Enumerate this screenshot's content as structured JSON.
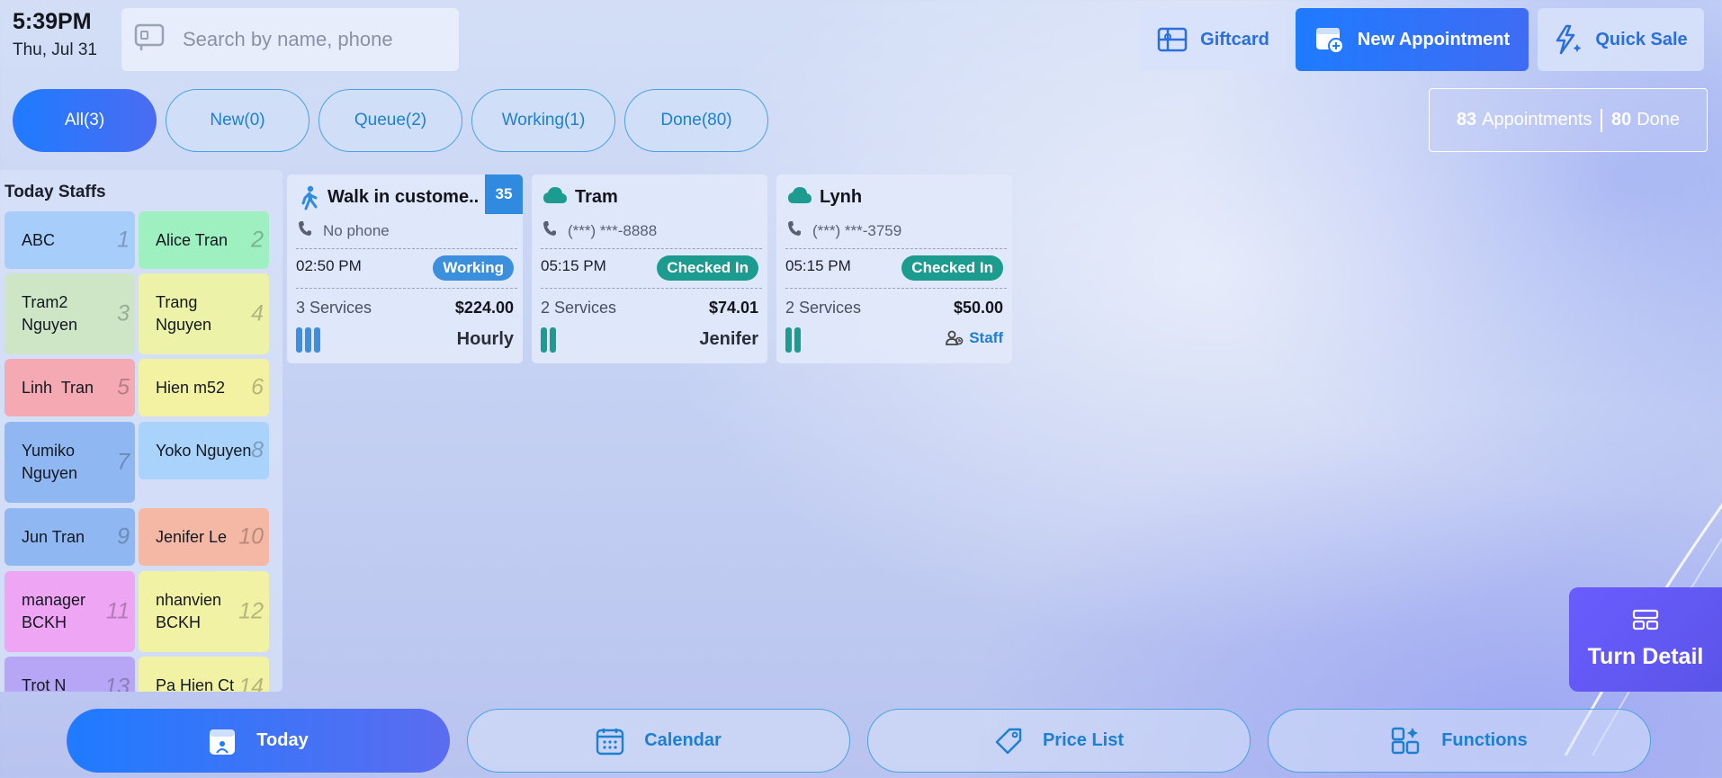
{
  "header": {
    "time": "5:39PM",
    "date": "Thu, Jul 31",
    "search_placeholder": "Search by name, phone"
  },
  "actions": {
    "giftcard": "Giftcard",
    "new_appointment": "New Appointment",
    "quick_sale": "Quick Sale"
  },
  "filters": [
    {
      "label": "All(3)",
      "active": true
    },
    {
      "label": "New(0)"
    },
    {
      "label": "Queue(2)"
    },
    {
      "label": "Working(1)"
    },
    {
      "label": "Done(80)"
    }
  ],
  "summary": {
    "appointments_count": "83",
    "appointments_label": "Appointments",
    "done_count": "80",
    "done_label": "Done"
  },
  "staff_panel": {
    "title": "Today Staffs",
    "staffs": [
      {
        "name": "ABC",
        "num": "1",
        "color": "#a7cdfb"
      },
      {
        "name": "Alice Tran",
        "num": "2",
        "color": "#9ff0c0"
      },
      {
        "name": "Tram2 Nguyen",
        "num": "3",
        "color": "#cfe6c6"
      },
      {
        "name": "Trang Nguyen",
        "num": "4",
        "color": "#ecf3a8"
      },
      {
        "name": "Linh  Tran",
        "num": "5",
        "color": "#f5a9b3"
      },
      {
        "name": "Hien m52",
        "num": "6",
        "color": "#f3f1a2"
      },
      {
        "name": "Yumiko Nguyen",
        "num": "7",
        "color": "#8fb8f2"
      },
      {
        "name": "Yoko Nguyen",
        "num": "8",
        "color": "#a9d3fb"
      },
      {
        "name": "Jun Tran",
        "num": "9",
        "color": "#8fb8f2"
      },
      {
        "name": "Jenifer Le",
        "num": "10",
        "color": "#f4b8a4"
      },
      {
        "name": "manager BCKH",
        "num": "11",
        "color": "#eea5f3"
      },
      {
        "name": "nhanvien BCKH",
        "num": "12",
        "color": "#f1f2a4"
      },
      {
        "name": "Trot N",
        "num": "13",
        "color": "#b7a6f5"
      },
      {
        "name": "Pa Hien Ct",
        "num": "14",
        "color": "#f1f2a4"
      }
    ]
  },
  "appointments": [
    {
      "name": "Walk in custome..",
      "type_icon": "walk-icon",
      "badge": "35",
      "phone": "No phone",
      "time": "02:50 PM",
      "status": "Working",
      "status_color": "#3b8fdc",
      "services": "3 Services",
      "price": "$224.00",
      "footer": "Hourly",
      "bar_color": "#3b8fdc",
      "bar_count": 3
    },
    {
      "name": "Tram",
      "type_icon": "cloud-icon",
      "phone": "(***) ***-8888",
      "time": "05:15 PM",
      "status": "Checked In",
      "status_color": "#1c9c8e",
      "services": "2 Services",
      "price": "$74.01",
      "footer": "Jenifer",
      "bar_color": "#1c9c8e",
      "bar_count": 2
    },
    {
      "name": "Lynh",
      "type_icon": "cloud-icon",
      "phone": "(***) ***-3759",
      "time": "05:15 PM",
      "status": "Checked In",
      "status_color": "#1c9c8e",
      "services": "2 Services",
      "price": "$50.00",
      "footer": "Staff",
      "footer_icon": "staff-icon",
      "bar_color": "#1c9c8e",
      "bar_count": 2
    }
  ],
  "turn_detail": {
    "label": "Turn Detail"
  },
  "bottom_nav": [
    {
      "label": "Today",
      "icon": "today-icon",
      "active": true
    },
    {
      "label": "Calendar",
      "icon": "calendar-icon"
    },
    {
      "label": "Price List",
      "icon": "price-tag-icon"
    },
    {
      "label": "Functions",
      "icon": "functions-icon"
    }
  ]
}
